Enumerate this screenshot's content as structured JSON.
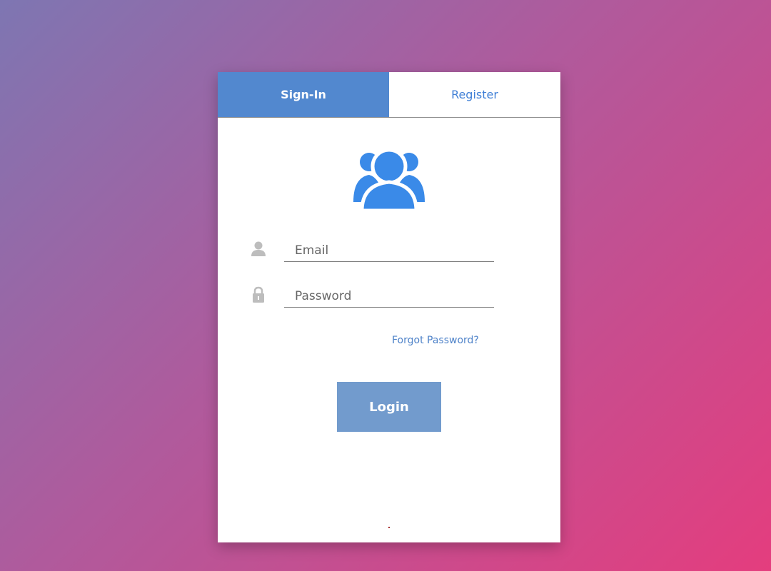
{
  "tabs": {
    "signin_label": "Sign-In",
    "register_label": "Register"
  },
  "form": {
    "email_placeholder": "Email",
    "password_placeholder": "Password",
    "forgot_label": "Forgot Password?",
    "login_label": "Login"
  },
  "icons": {
    "header": "users-group-icon",
    "email": "user-icon",
    "password": "lock-icon"
  },
  "colors": {
    "accent": "#5288cf",
    "icon_blue": "#3a8ae8",
    "login_button": "#729bcd",
    "link": "#4f83c9",
    "muted_icon": "#bdbdbd"
  }
}
